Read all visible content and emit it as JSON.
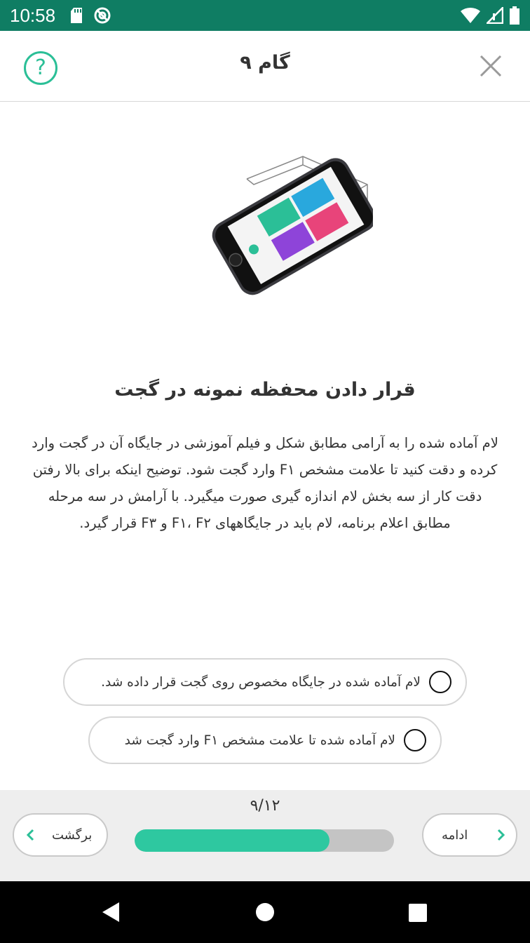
{
  "status_bar": {
    "time": "10:58"
  },
  "header": {
    "title": "گام ۹",
    "help_symbol": "?"
  },
  "step": {
    "heading": "قرار دادن محفظه نمونه در گجت",
    "body": "لام آماده شده را به آرامی مطابق شکل و فیلم آموزشی در جایگاه آن در گجت وارد کرده و دقت کنید تا علامت مشخص F۱ وارد گجت شود. توضیح اینکه برای بالا رفتن دقت کار از سه بخش لام اندازه گیری صورت میگیرد. با آرامش در سه مرحله مطابق اعلام برنامه، لام باید در جایگاههای F۱، F۲ و F۳ قرار گیرد."
  },
  "checklist": [
    {
      "label": "لام آماده شده در جایگاه مخصوص روی گجت قرار داده شد.",
      "checked": false
    },
    {
      "label": "لام آماده شده تا علامت مشخص F۱ وارد گجت شد",
      "checked": false
    }
  ],
  "progress": {
    "label": "۹/۱۲",
    "current": 9,
    "total": 12,
    "fraction": 0.75
  },
  "navigation": {
    "back_label": "برگشت",
    "next_label": "ادامه"
  },
  "colors": {
    "status_bar": "#0f7d63",
    "accent": "#2bbf97",
    "progress_fill": "#2ec8a0"
  }
}
